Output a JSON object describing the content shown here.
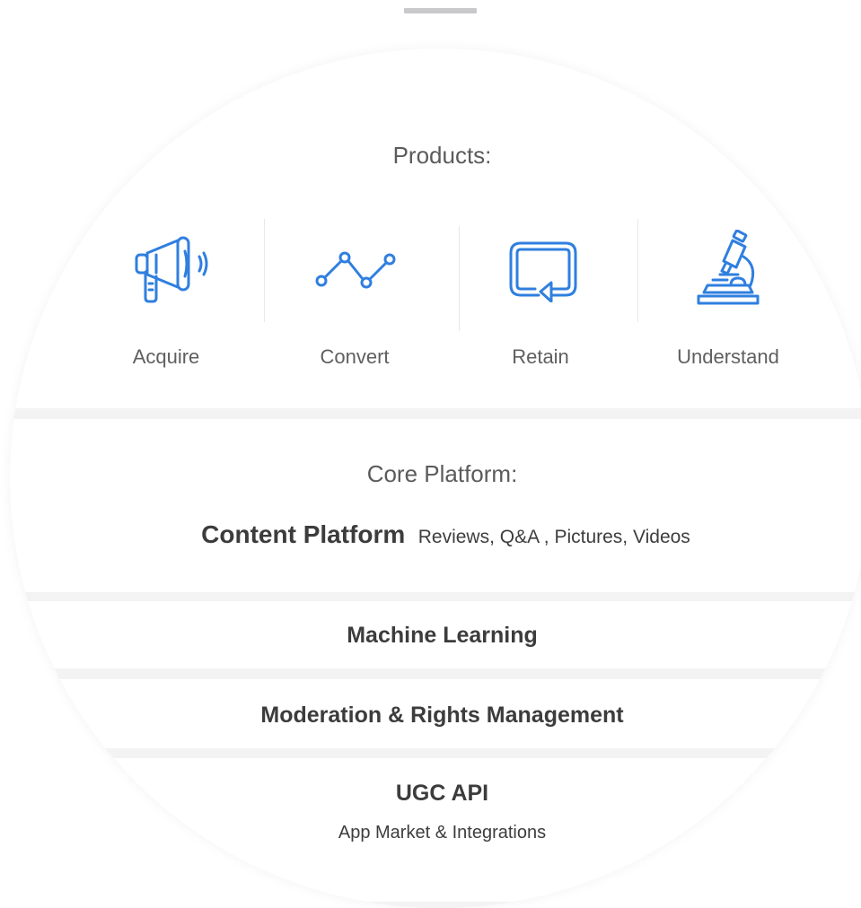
{
  "products": {
    "heading": "Products:",
    "items": [
      {
        "label": "Acquire",
        "icon": "megaphone-icon"
      },
      {
        "label": "Convert",
        "icon": "line-graph-icon"
      },
      {
        "label": "Retain",
        "icon": "loop-arrow-icon"
      },
      {
        "label": "Understand",
        "icon": "microscope-icon"
      }
    ],
    "icon_color": "#2f7fdf"
  },
  "core": {
    "heading": "Core Platform:",
    "content_platform": "Content Platform",
    "content_platform_detail": "Reviews, Q&A , Pictures, Videos"
  },
  "layers": {
    "machine_learning": "Machine Learning",
    "moderation": "Moderation & Rights Management",
    "api_title": "UGC API",
    "api_sub": "App Market & Integrations"
  }
}
